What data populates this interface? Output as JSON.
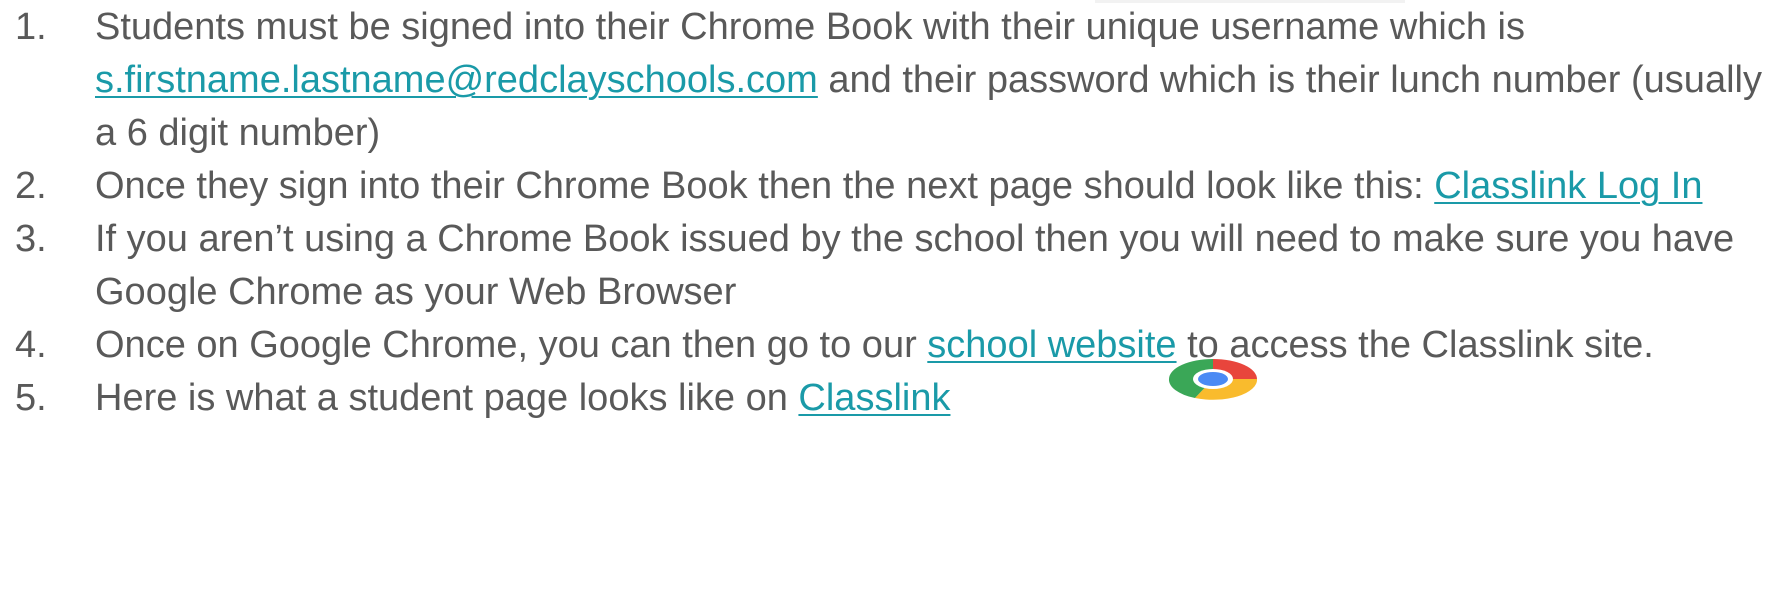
{
  "items": [
    {
      "number": "1.",
      "text_a": "Students must be signed into their Chrome Book with their unique username which is ",
      "link": "s.firstname.lastname@redclayschools.com",
      "text_b": " and their password which is their lunch number (usually a 6 digit number)"
    },
    {
      "number": "2.",
      "text_a": "Once they sign into their Chrome Book then the next page should look like this: ",
      "link": "Classlink Log In"
    },
    {
      "number": "3.",
      "text_a": "If you aren’t using a Chrome Book issued by the school then you will need to make sure you have Google Chrome as your Web Browser"
    },
    {
      "number": "4.",
      "text_a": "Once on Google Chrome, you can then go to our ",
      "link": "school website",
      "text_b": " to access the Classlink site."
    },
    {
      "number": "5.",
      "text_a": "Here is what a student page looks like on ",
      "link": "Classlink"
    }
  ],
  "icons": {
    "chrome": "google-chrome-logo"
  },
  "colors": {
    "text": "#595959",
    "link": "#1a9aa8"
  }
}
